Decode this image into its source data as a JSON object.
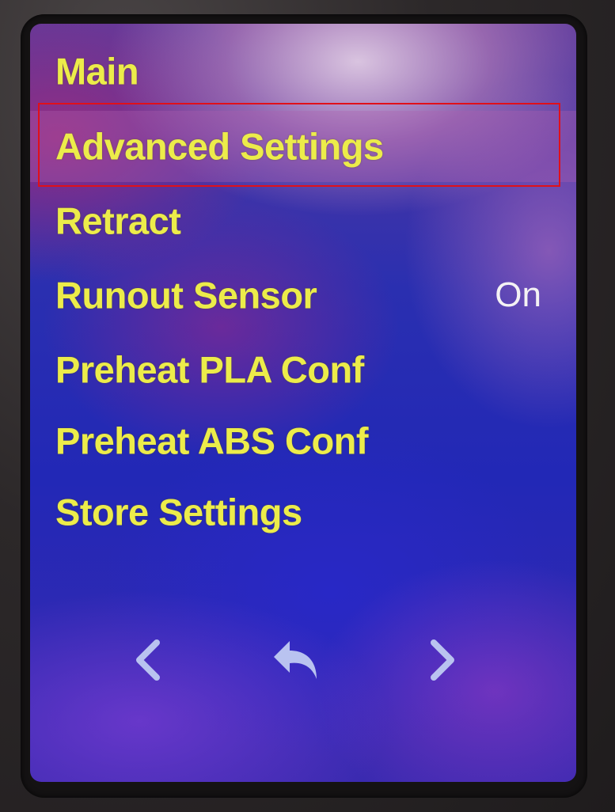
{
  "menu": {
    "items": [
      {
        "label": "Main",
        "value": ""
      },
      {
        "label": "Advanced Settings",
        "value": ""
      },
      {
        "label": "Retract",
        "value": ""
      },
      {
        "label": "Runout Sensor",
        "value": "On"
      },
      {
        "label": "Preheat PLA Conf",
        "value": ""
      },
      {
        "label": "Preheat ABS Conf",
        "value": ""
      },
      {
        "label": "Store Settings",
        "value": ""
      }
    ],
    "selected_index": 1
  },
  "nav": {
    "previous_icon": "chevron-left-icon",
    "back_icon": "return-arrow-icon",
    "next_icon": "chevron-right-icon"
  },
  "colors": {
    "label": "#ecec4a",
    "value": "#f4f2f4",
    "highlight_border": "#e0101a",
    "nav_icon": "#b9c3f0"
  }
}
